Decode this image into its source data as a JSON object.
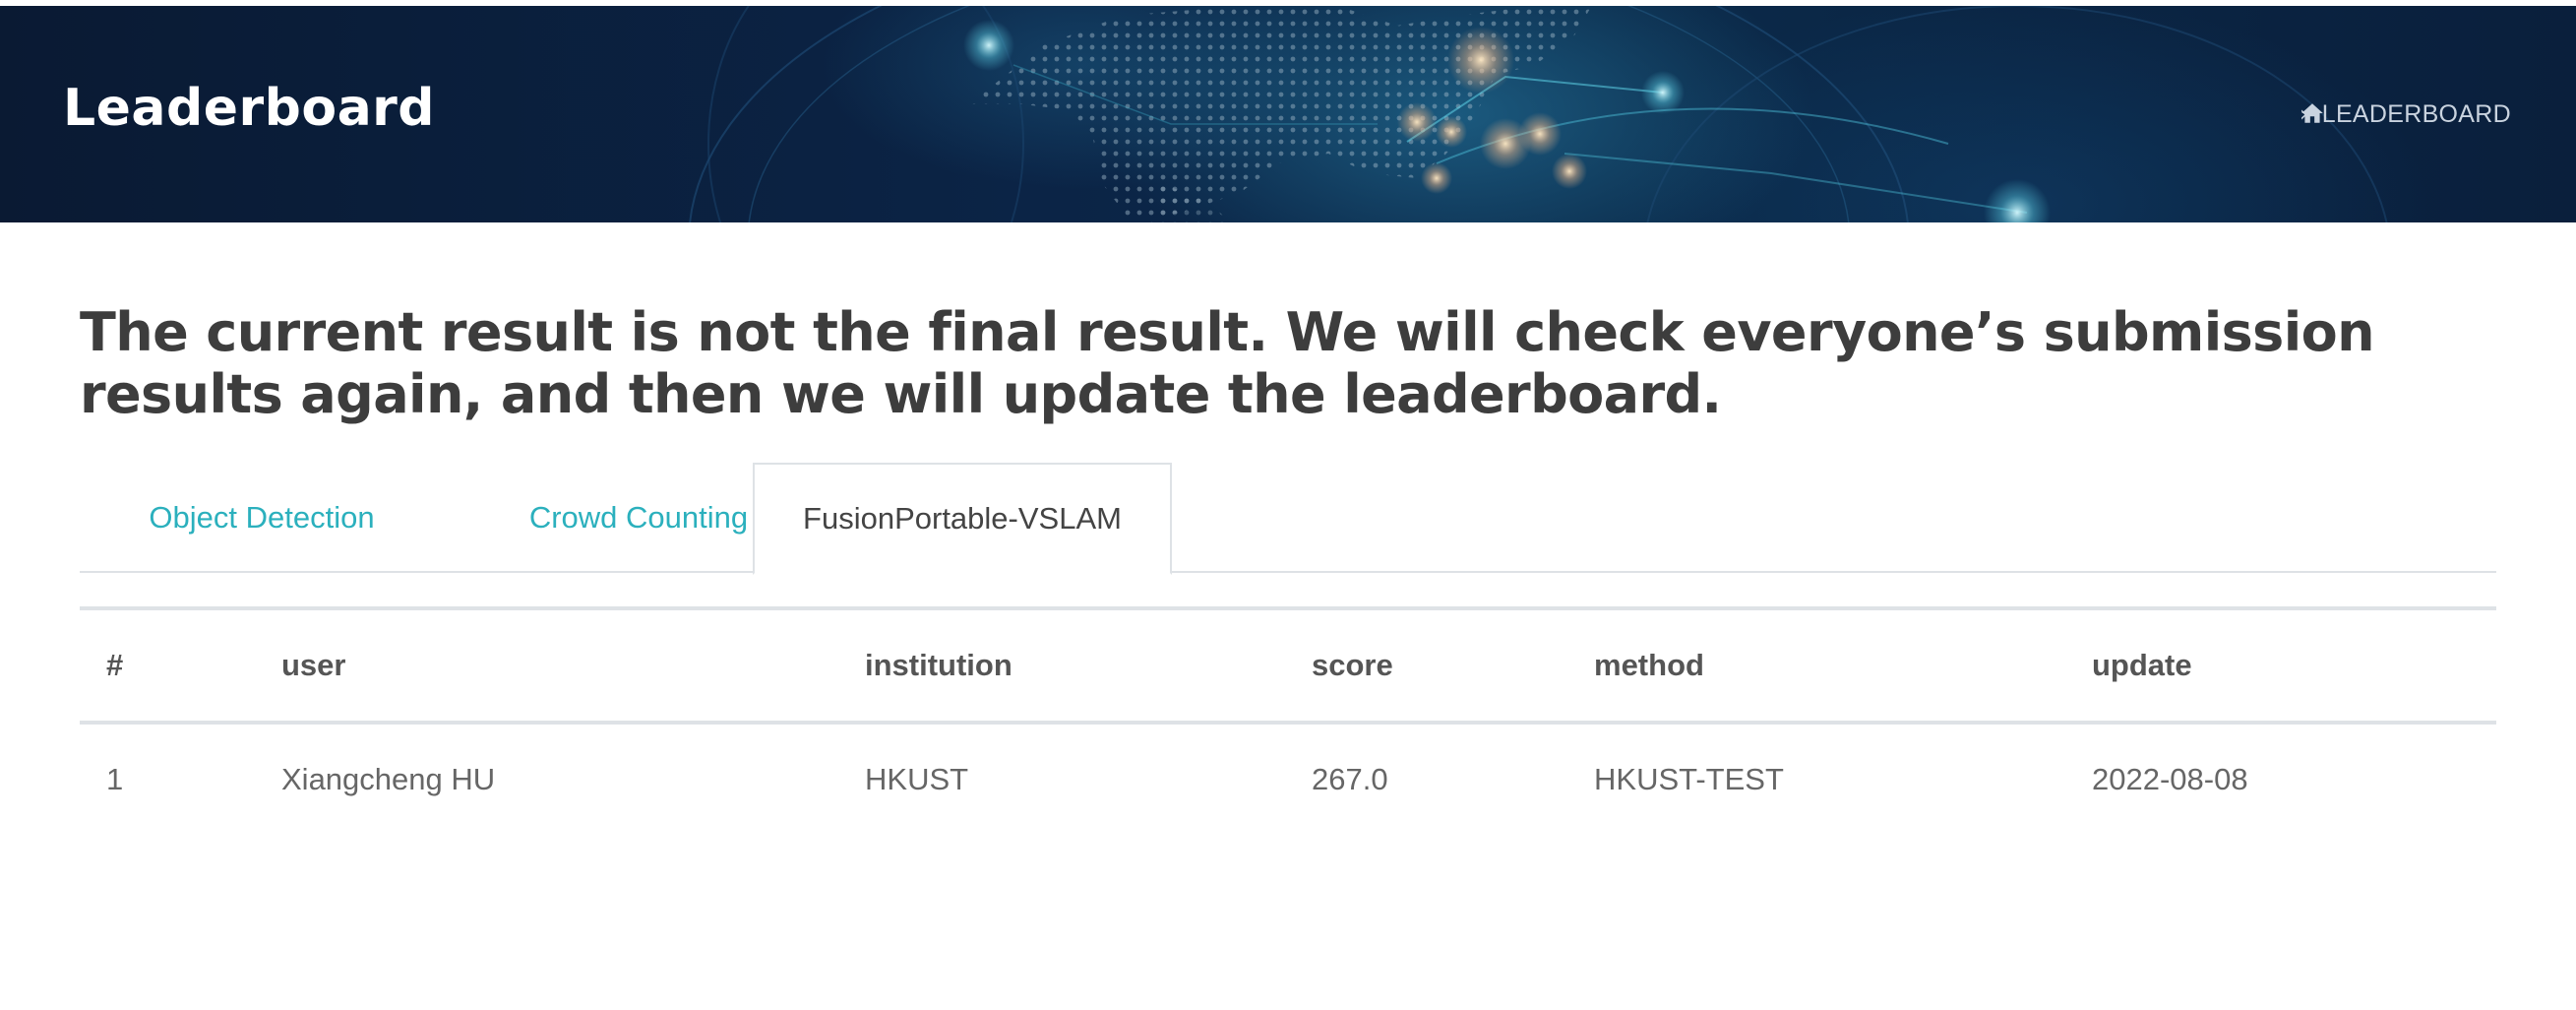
{
  "header": {
    "title": "Leaderboard",
    "breadcrumb": {
      "home_icon": "home-icon",
      "separator_icon": "chevron-right-icon",
      "current": "LEADERBOARD"
    }
  },
  "notice": "The current result is not the final result. We will check everyone’s submission results again, and then we will update the leaderboard.",
  "tabs": [
    {
      "label": "Object Detection",
      "active": false
    },
    {
      "label": "Crowd Counting",
      "active": false
    },
    {
      "label": "FusionPortable-VSLAM",
      "active": true
    }
  ],
  "table": {
    "columns": [
      "#",
      "user",
      "institution",
      "score",
      "method",
      "update"
    ],
    "rows": [
      [
        "1",
        "Xiangcheng HU",
        "HKUST",
        "267.0",
        "HKUST-TEST",
        "2022-08-08"
      ]
    ]
  },
  "colors": {
    "hero_background": "#0b2446",
    "accent": "#2bb0bd",
    "heading_text": "#3d3d3d",
    "body_text": "#666666",
    "border": "#dee2e6"
  }
}
